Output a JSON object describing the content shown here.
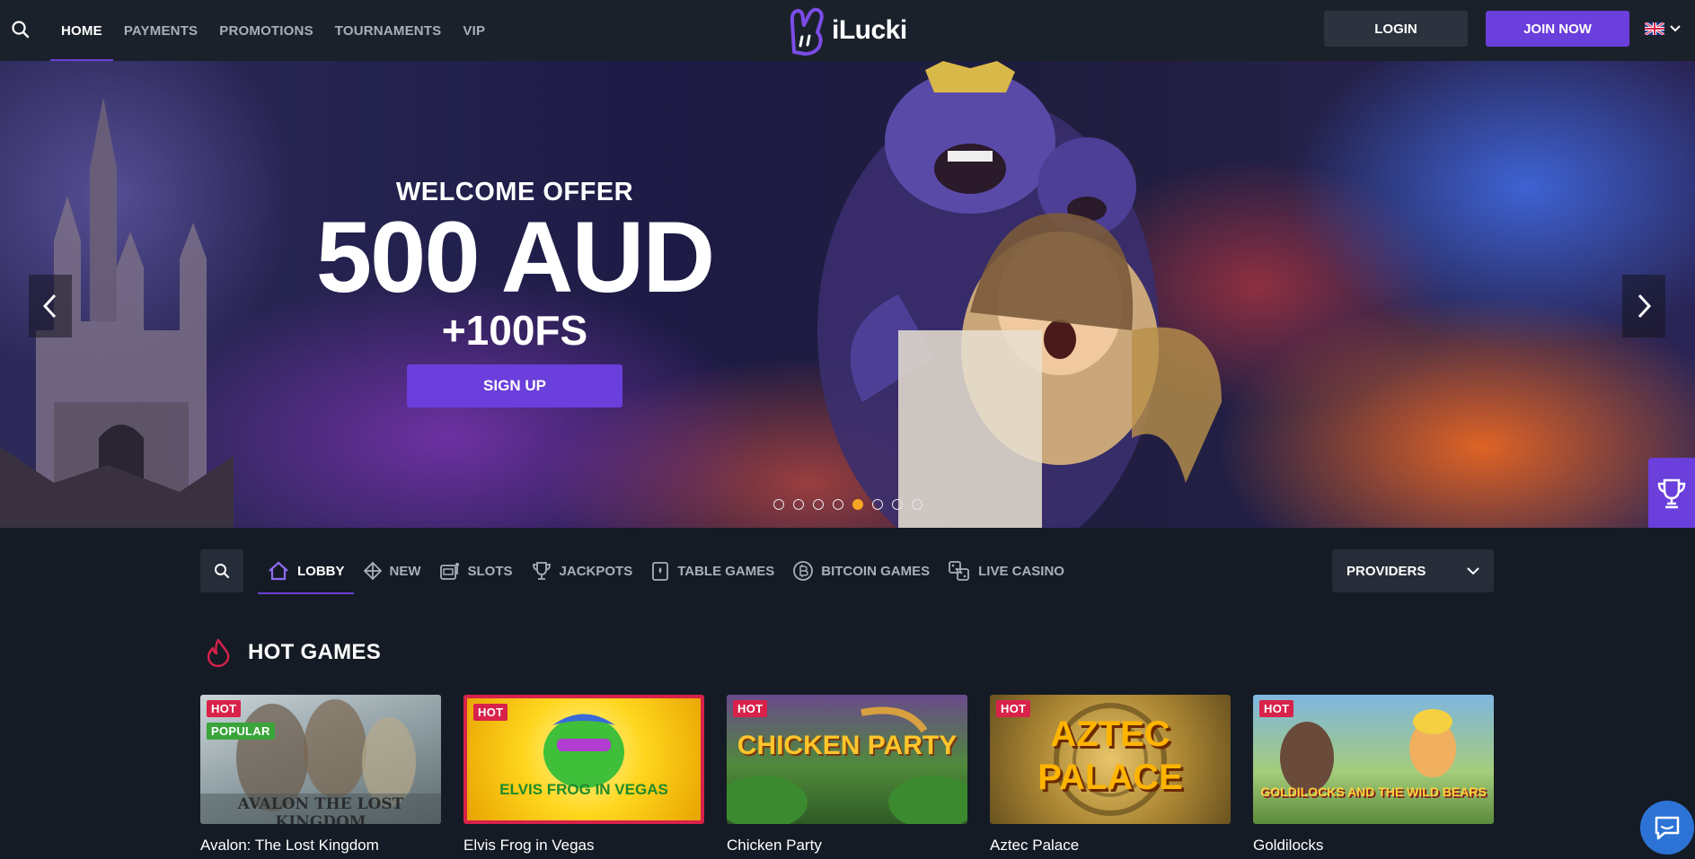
{
  "header": {
    "nav": [
      "HOME",
      "PAYMENTS",
      "PROMOTIONS",
      "TOURNAMENTS",
      "VIP"
    ],
    "active_nav": "HOME",
    "logo_text": "iLucki",
    "login_label": "LOGIN",
    "join_label": "JOIN NOW",
    "language_icon": "uk-flag-icon"
  },
  "hero": {
    "offer_title": "WELCOME OFFER",
    "offer_amount": "500 AUD",
    "offer_spins": "+100FS",
    "signup_label": "SIGN UP",
    "slide_count": 8,
    "active_slide": 5
  },
  "categories": {
    "items": [
      "LOBBY",
      "NEW",
      "SLOTS",
      "JACKPOTS",
      "TABLE GAMES",
      "BITCOIN GAMES",
      "LIVE CASINO"
    ],
    "active": "LOBBY",
    "providers_label": "PROVIDERS"
  },
  "hot_games": {
    "title": "HOT GAMES",
    "games": [
      {
        "name": "Avalon: The Lost Kingdom",
        "badges": [
          "HOT",
          "POPULAR"
        ],
        "thumb_text": "AVALON THE LOST KINGDOM"
      },
      {
        "name": "Elvis Frog in Vegas",
        "badges": [
          "HOT"
        ],
        "thumb_text": "ELVIS FROG IN VEGAS"
      },
      {
        "name": "Chicken Party",
        "badges": [
          "HOT"
        ],
        "thumb_text": "CHICKEN PARTY"
      },
      {
        "name": "Aztec Palace",
        "badges": [
          "HOT"
        ],
        "thumb_text": "AZTEC PALACE"
      },
      {
        "name": "Goldilocks",
        "badges": [
          "HOT"
        ],
        "thumb_text": "GOLDILOCKS AND THE WILD BEARS"
      }
    ]
  },
  "colors": {
    "accent": "#6b3fdb",
    "hot_badge": "#d8224a",
    "popular_badge": "#3aa53a",
    "background": "#151b24"
  }
}
